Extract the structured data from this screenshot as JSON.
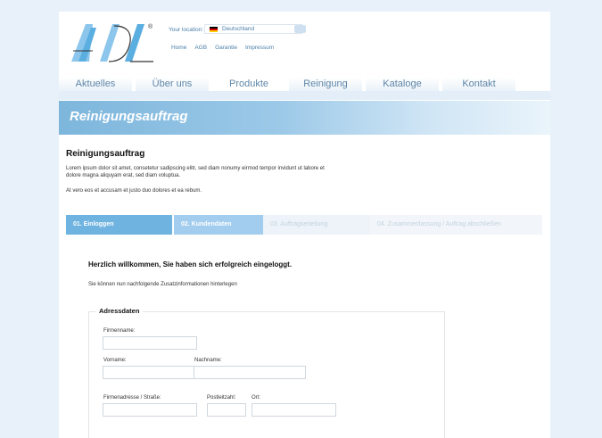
{
  "header": {
    "logo_text": "ADL",
    "registered_mark": "®",
    "location_label": "Your location:",
    "location_value": "Deutschland",
    "links": [
      "Home",
      "AGB",
      "Garantie",
      "Impressum"
    ]
  },
  "mainnav": {
    "tabs": [
      {
        "label": "Aktuelles"
      },
      {
        "label": "Über uns"
      },
      {
        "label": "Produkte"
      },
      {
        "label": "Reinigung"
      },
      {
        "label": "Kataloge"
      },
      {
        "label": "Kontakt"
      }
    ],
    "active": "Produkte"
  },
  "banner": {
    "title": "Reinigungsauftrag"
  },
  "content": {
    "title": "Reinigungsauftrag",
    "lorem1": "Lorem ipsum dolor sit amet, consetetur sadipscing elitr, sed diam nonumy eirmod tempor invidunt ut labore et dolore magna aliquyam erat, sed diam voluptua.",
    "lorem2": "At vero eos et accusam et justo duo dolores et ea rebum."
  },
  "steps": [
    {
      "label": "01. Einloggen"
    },
    {
      "label": "02. Kundendaten"
    },
    {
      "label": "03. Auftragserteilung"
    },
    {
      "label": "04. Zusammenfassung / Auftrag abschließen"
    }
  ],
  "form": {
    "welcome": "Herzlich willkommen, Sie haben sich erfolgreich eingeloggt.",
    "info": "Sie können nun nachfolgende Zusatzinformationen hinterlegen",
    "legend": "Adressdaten",
    "labels": {
      "firmenname": "Firmenname:",
      "vorname": "Vorname:",
      "nachname": "Nachname:",
      "strasse": "Firmenadresse / Straße:",
      "plz": "Postleitzahl:",
      "ort": "Ort:"
    },
    "values": {
      "firmenname": "",
      "vorname": "",
      "nachname": "",
      "strasse": "",
      "plz": "",
      "ort": ""
    }
  },
  "colors": {
    "accent": "#6fb3e0",
    "banner": "#7db6dc",
    "background": "#e8f1fa"
  }
}
